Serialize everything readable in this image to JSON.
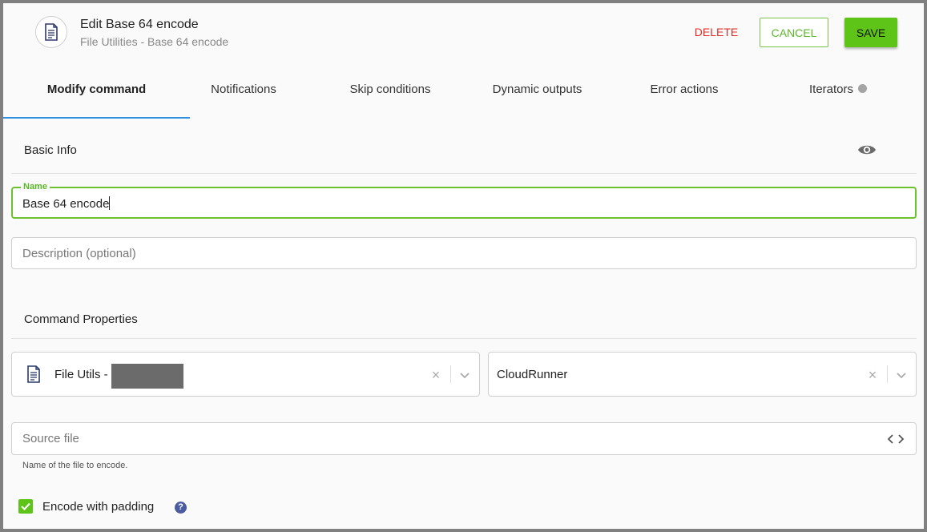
{
  "header": {
    "title": "Edit Base 64 encode",
    "subtitle": "File Utilities - Base 64 encode",
    "icon": "document-icon",
    "delete_label": "DELETE",
    "cancel_label": "CANCEL",
    "save_label": "SAVE"
  },
  "tabs": [
    {
      "label": "Modify command",
      "active": true
    },
    {
      "label": "Notifications"
    },
    {
      "label": "Skip conditions"
    },
    {
      "label": "Dynamic outputs"
    },
    {
      "label": "Error actions"
    },
    {
      "label": "Iterators"
    }
  ],
  "basic_info": {
    "title": "Basic Info",
    "name_legend": "Name",
    "name_value": "Base 64 encode",
    "description_placeholder": "Description (optional)"
  },
  "command_properties": {
    "title": "Command Properties",
    "integration_select": "File Utils -",
    "runner_select": "CloudRunner",
    "source_file_placeholder": "Source file",
    "source_file_helper": "Name of the file to encode."
  },
  "options": {
    "padding_label": "Encode with padding",
    "padding_checked": true,
    "help_glyph": "?"
  },
  "colors": {
    "accent_green": "#5ec418",
    "delete_red": "#e0302a",
    "tab_underline": "#2d8fe0",
    "help_blue": "#4a5b9f"
  }
}
